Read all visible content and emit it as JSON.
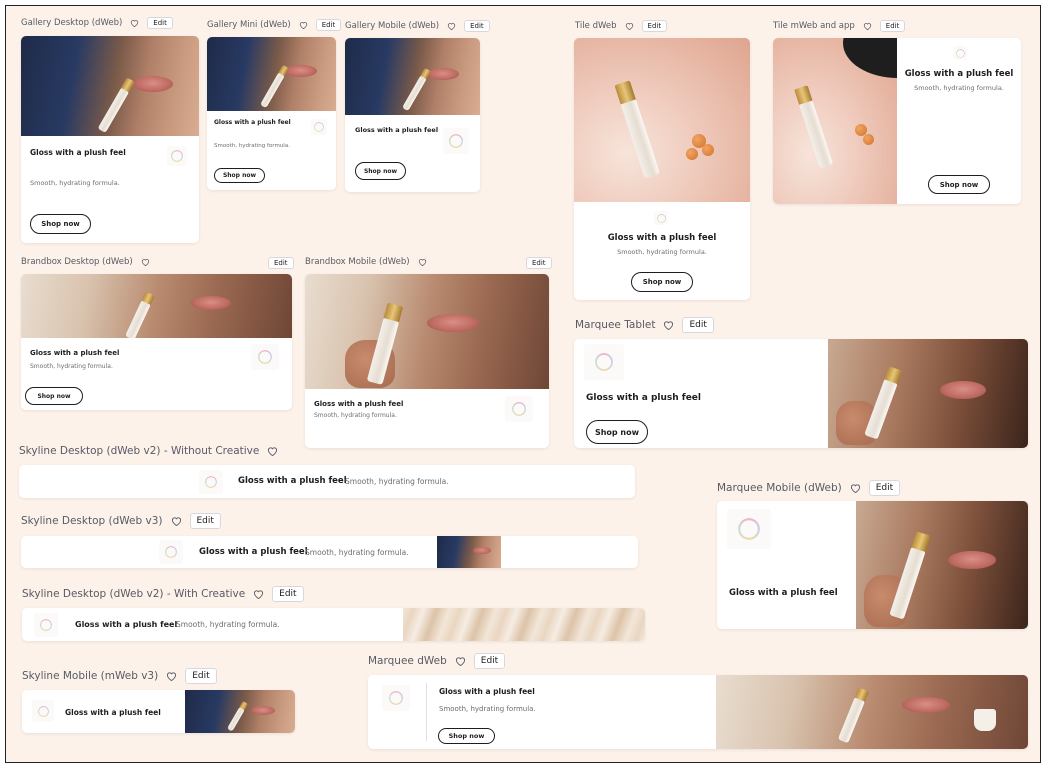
{
  "creative": {
    "headline": "Gloss with a plush feel",
    "subhead": "Smooth, hydrating formula.",
    "cta": "Shop now"
  },
  "ui": {
    "edit_label": "Edit",
    "favorite_icon": "heart-icon"
  },
  "variants": {
    "gallery_desktop": "Gallery Desktop (dWeb)",
    "gallery_mini": "Gallery Mini (dWeb)",
    "gallery_mobile": "Gallery Mobile (dWeb)",
    "tile_dweb": "Tile dWeb",
    "tile_mweb": "Tile mWeb and app",
    "brandbox_desktop": "Brandbox Desktop (dWeb)",
    "brandbox_mobile": "Brandbox Mobile (dWeb)",
    "marquee_tablet": "Marquee Tablet",
    "skyline_v2_without": "Skyline Desktop (dWeb v2) - Without Creative",
    "skyline_v3": "Skyline Desktop (dWeb v3)",
    "marquee_mobile": "Marquee Mobile (dWeb)",
    "skyline_v2_with": "Skyline Desktop (dWeb v2) - With Creative",
    "skyline_mobile": "Skyline Mobile (mWeb v3)",
    "marquee_dweb": "Marquee dWeb"
  },
  "colors": {
    "canvas": "#fdf2ea",
    "card": "#ffffff",
    "label": "#555a64",
    "ink": "#1d1d1f"
  }
}
